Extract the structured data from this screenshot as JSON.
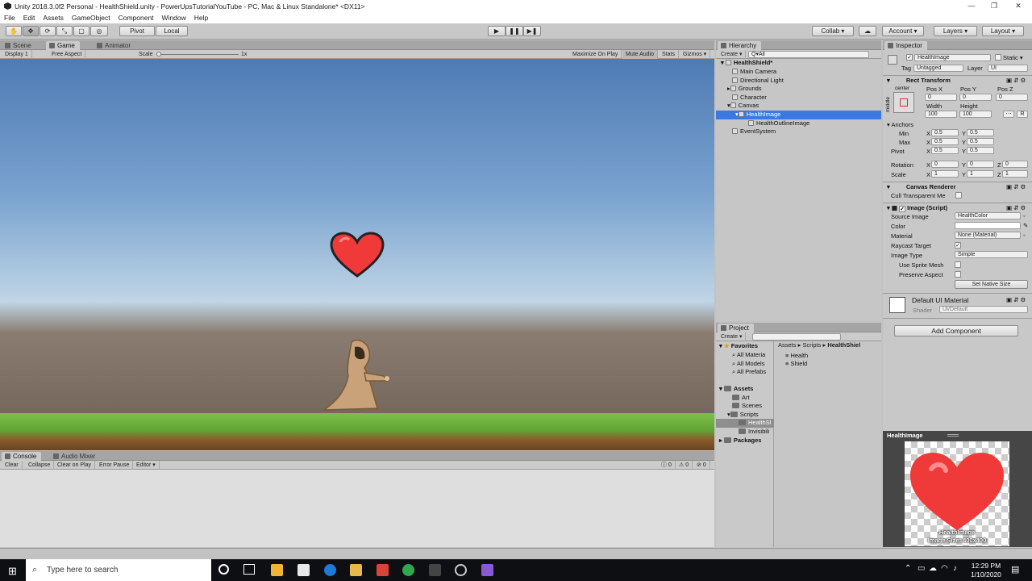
{
  "window": {
    "title": "Unity 2018.3.0f2 Personal - HealthShield.unity - PowerUpsTutorialYouTube - PC, Mac & Linux Standalone* <DX11>"
  },
  "menu": [
    "File",
    "Edit",
    "Assets",
    "GameObject",
    "Component",
    "Window",
    "Help"
  ],
  "toolbar": {
    "pivot": "Pivot",
    "local": "Local",
    "collab": "Collab ▾",
    "account": "Account ▾",
    "layers": "Layers ▾",
    "layout": "Layout ▾"
  },
  "game": {
    "tabs": [
      "Scene",
      "Game",
      "Animator"
    ],
    "display": "Display 1",
    "aspect": "Free Aspect",
    "scale_label": "Scale",
    "scale_value": "1x",
    "maximize": "Maximize On Play",
    "mute": "Mute Audio",
    "stats": "Stats",
    "gizmos": "Gizmos ▾"
  },
  "console": {
    "tabs": [
      "Console",
      "Audio Mixer"
    ],
    "clear": "Clear",
    "collapse": "Collapse",
    "clear_on_play": "Clear on Play",
    "error_pause": "Error Pause",
    "editor": "Editor ▾",
    "count_info": "0",
    "count_warn": "0",
    "count_err": "0"
  },
  "hierarchy": {
    "tab": "Hierarchy",
    "create": "Create ▾",
    "search_placeholder": "Q▾All",
    "items": [
      {
        "label": "HealthShield*"
      },
      {
        "label": "Main Camera"
      },
      {
        "label": "Directional Light"
      },
      {
        "label": "Grounds"
      },
      {
        "label": "Character"
      },
      {
        "label": "Canvas"
      },
      {
        "label": "HealthImage"
      },
      {
        "label": "HealthOutlineImage"
      },
      {
        "label": "EventSystem"
      }
    ]
  },
  "project": {
    "tab": "Project",
    "create": "Create ▾",
    "favorites": "Favorites",
    "fav_items": [
      "All Materia",
      "All Models",
      "All Prefabs"
    ],
    "assets": "Assets",
    "asset_items": [
      "Art",
      "Scenes",
      "Scripts",
      "HealthSl",
      "Invisibili"
    ],
    "packages": "Packages",
    "breadcrumb": [
      "Assets",
      "Scripts",
      "HealthShiel"
    ],
    "files": [
      "Health",
      "Shield"
    ]
  },
  "inspector": {
    "tab": "Inspector",
    "name": "HealthImage",
    "static": "Static ▾",
    "tag_label": "Tag",
    "tag": "Untagged",
    "layer_label": "Layer",
    "layer": "UI",
    "rect": {
      "title": "Rect Transform",
      "anchor_h": "center",
      "anchor_v": "middle",
      "posx_l": "Pos X",
      "posy_l": "Pos Y",
      "posz_l": "Pos Z",
      "posx": "0",
      "posy": "0",
      "posz": "0",
      "width_l": "Width",
      "height_l": "Height",
      "width": "100",
      "height": "100",
      "r": "R",
      "anchors": "Anchors",
      "min_l": "Min",
      "max_l": "Max",
      "pivot_l": "Pivot",
      "x": "X",
      "y": "Y",
      "z": "Z",
      "min_x": "0.5",
      "min_y": "0.5",
      "max_x": "0.5",
      "max_y": "0.5",
      "pivot_x": "0.5",
      "pivot_y": "0.5",
      "rotation_l": "Rotation",
      "rot_x": "0",
      "rot_y": "0",
      "rot_z": "0",
      "scale_l": "Scale",
      "sc_x": "1",
      "sc_y": "1",
      "sc_z": "1"
    },
    "canvas_renderer": {
      "title": "Canvas Renderer",
      "cull": "Cull Transparent Me"
    },
    "image": {
      "title": "Image (Script)",
      "source_l": "Source Image",
      "source": "HealthColor",
      "color_l": "Color",
      "material_l": "Material",
      "material": "None (Material)",
      "raycast_l": "Raycast Target",
      "type_l": "Image Type",
      "type": "Simple",
      "sprite_mesh_l": "Use Sprite Mesh",
      "preserve_l": "Preserve Aspect",
      "native": "Set Native Size"
    },
    "material": {
      "title": "Default UI Material",
      "shader_l": "Shader",
      "shader": "UI/Default"
    },
    "add_component": "Add Component",
    "preview_title": "HealthImage",
    "preview_caption": "HealthImage",
    "preview_size": "Image Size: 400x400"
  },
  "taskbar": {
    "search": "Type here to search",
    "time": "12:29 PM",
    "date": "1/10/2020"
  },
  "colors": {
    "selection": "#3c78e0",
    "heart": "#f03a3a",
    "grass": "#6fae3c"
  }
}
